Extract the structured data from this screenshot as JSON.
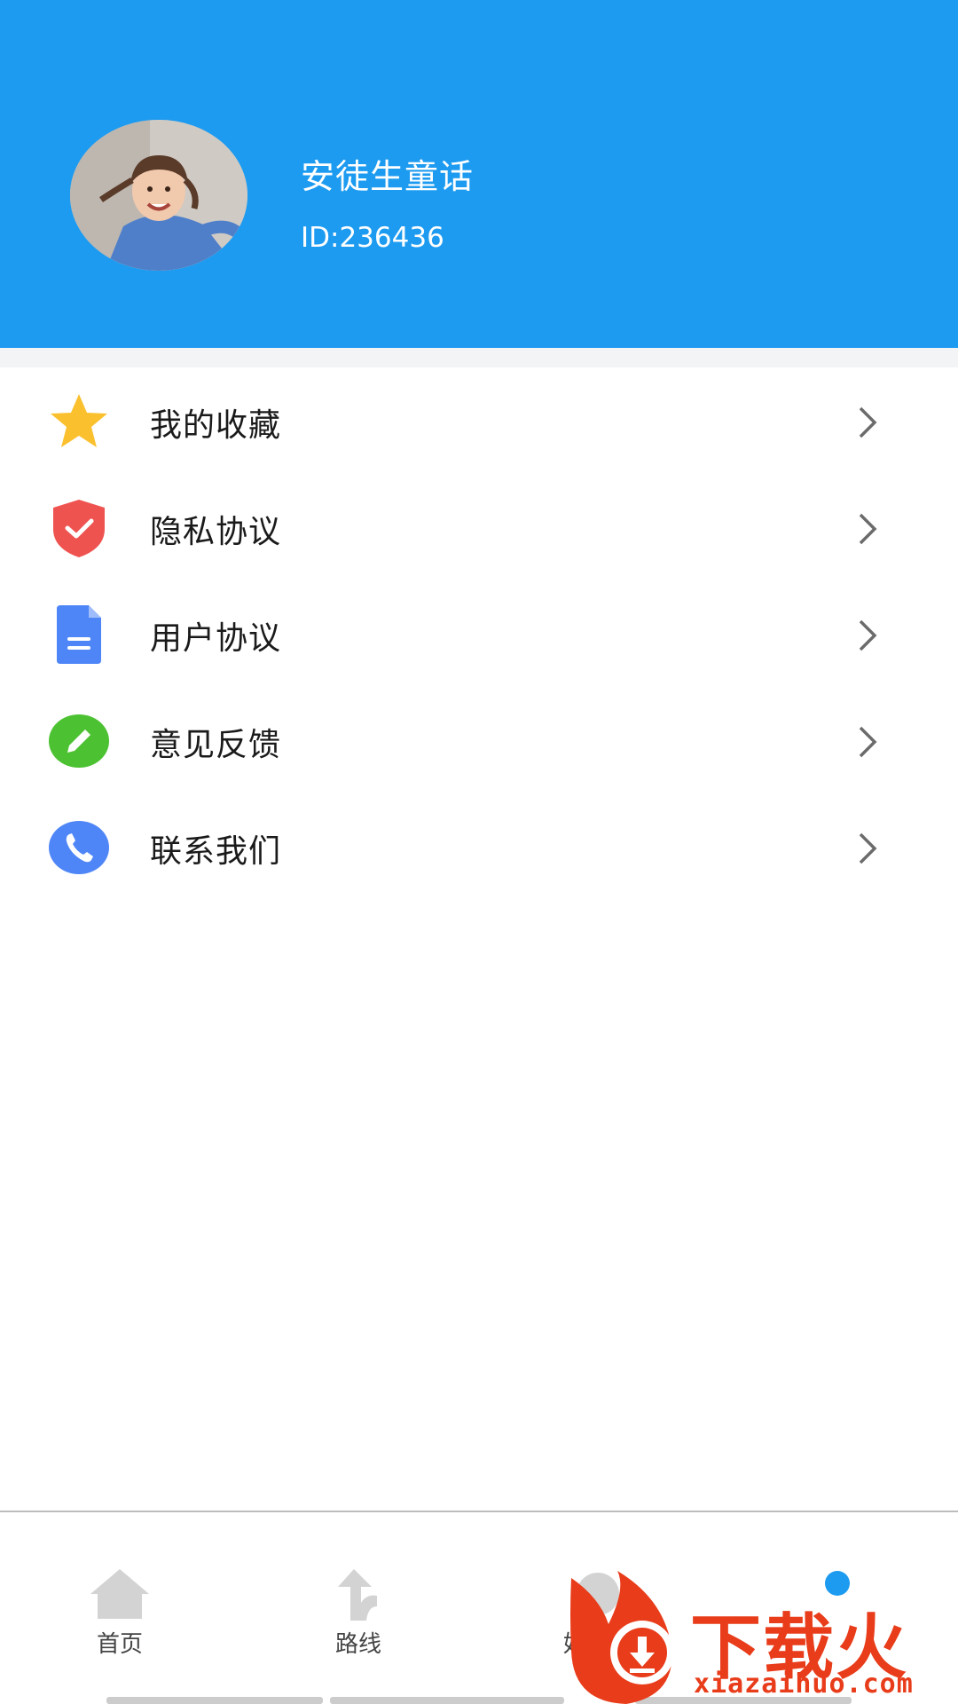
{
  "profile": {
    "name": "安徒生童话",
    "id_text": "ID:236436"
  },
  "menu": {
    "items": [
      {
        "label": "我的收藏",
        "icon": "star-icon",
        "color": "#fbc02d"
      },
      {
        "label": "隐私协议",
        "icon": "shield-check-icon",
        "color": "#ef5350"
      },
      {
        "label": "用户协议",
        "icon": "document-icon",
        "color": "#4f86f7"
      },
      {
        "label": "意见反馈",
        "icon": "pencil-icon",
        "color": "#4cc232"
      },
      {
        "label": "联系我们",
        "icon": "phone-icon",
        "color": "#4f86f7"
      }
    ]
  },
  "tabbar": {
    "tabs": [
      {
        "label": "首页",
        "icon": "home-icon"
      },
      {
        "label": "路线",
        "icon": "route-icon"
      },
      {
        "label": "好生活",
        "icon": "life-icon"
      },
      {
        "label": "",
        "icon": "profile-icon"
      }
    ]
  },
  "watermark": {
    "brand": "下载火",
    "domain": "xiazaihuo.com"
  },
  "colors": {
    "header": "#1d9bf0",
    "watermark": "#e83c1a"
  }
}
